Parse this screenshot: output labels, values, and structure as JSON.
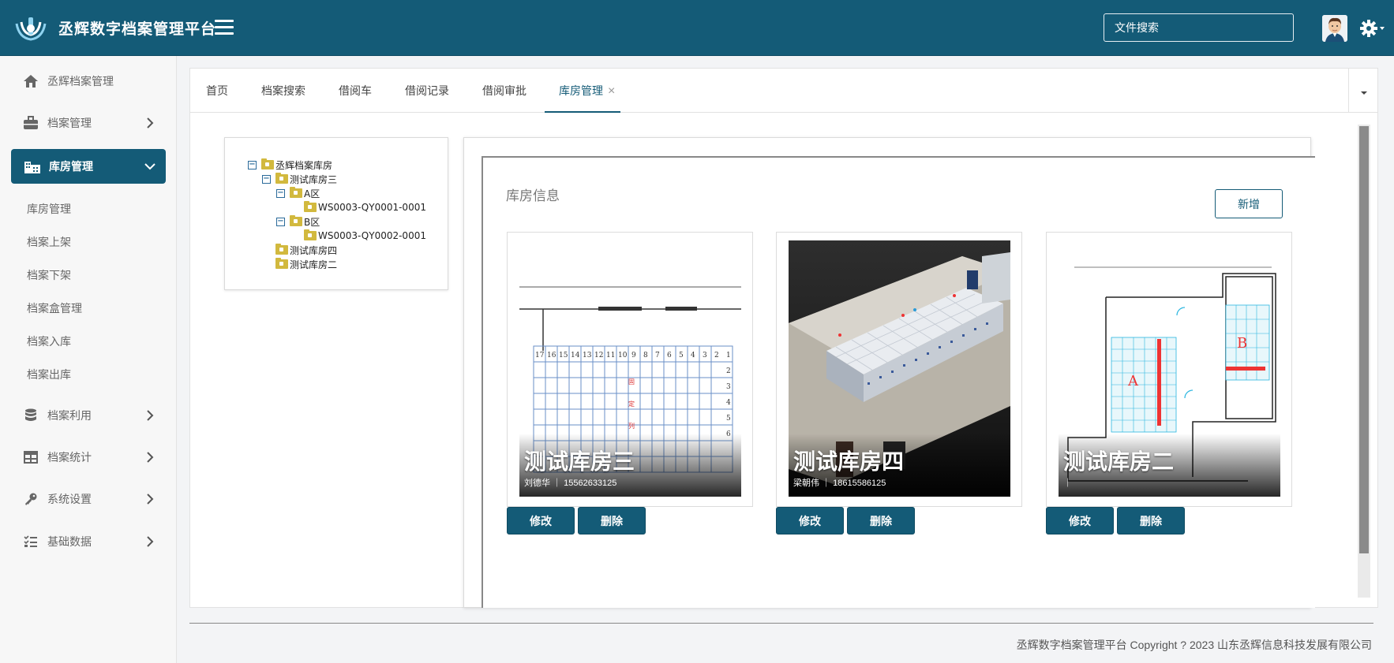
{
  "header": {
    "brand": "丞辉数字档案管理平台",
    "search_placeholder": "文件搜索"
  },
  "sidebar": {
    "items": [
      {
        "label": "丞辉档案管理"
      },
      {
        "label": "档案管理"
      },
      {
        "label": "库房管理"
      },
      {
        "label": "档案利用"
      },
      {
        "label": "档案统计"
      },
      {
        "label": "系统设置"
      },
      {
        "label": "基础数据"
      }
    ],
    "sub_items": [
      {
        "label": "库房管理"
      },
      {
        "label": "档案上架"
      },
      {
        "label": "档案下架"
      },
      {
        "label": "档案盒管理"
      },
      {
        "label": "档案入库"
      },
      {
        "label": "档案出库"
      }
    ]
  },
  "tabs": [
    {
      "label": "首页"
    },
    {
      "label": "档案搜索"
    },
    {
      "label": "借阅车"
    },
    {
      "label": "借阅记录"
    },
    {
      "label": "借阅审批"
    },
    {
      "label": "库房管理"
    }
  ],
  "tree": {
    "root": "丞辉档案库房",
    "n1": "测试库房三",
    "n1a": "A区",
    "n1a1": "WS0003-QY0001-0001",
    "n1b": "B区",
    "n1b1": "WS0003-QY0002-0001",
    "n2": "测试库房四",
    "n3": "测试库房二"
  },
  "main": {
    "section_title": "库房信息",
    "add_label": "新增"
  },
  "cards": [
    {
      "name": "测试库房三",
      "contact": "刘德华 ｜ 15562633125",
      "edit": "修改",
      "delete": "删除"
    },
    {
      "name": "测试库房四",
      "contact": "梁朝伟 ｜ 18615586125",
      "edit": "修改",
      "delete": "删除"
    },
    {
      "name": "测试库房二",
      "contact": "｜",
      "edit": "修改",
      "delete": "删除"
    }
  ],
  "footer": {
    "text": "丞辉数字档案管理平台 Copyright ? 2023 山东丞辉信息科技发展有限公司"
  },
  "colors": {
    "primary": "#145b77",
    "folder": "#d2b93e",
    "tree_toggle": "#2a6a9a"
  },
  "icons": {
    "logo": "chenghui-logo",
    "menu": "hamburger-icon",
    "settings": "gear-icon",
    "home": "home-icon",
    "archive": "briefcase-icon",
    "warehouse": "building-icon",
    "utilization": "database-icon",
    "statistics": "table-icon",
    "system": "key-icon",
    "base": "list-check-icon"
  }
}
